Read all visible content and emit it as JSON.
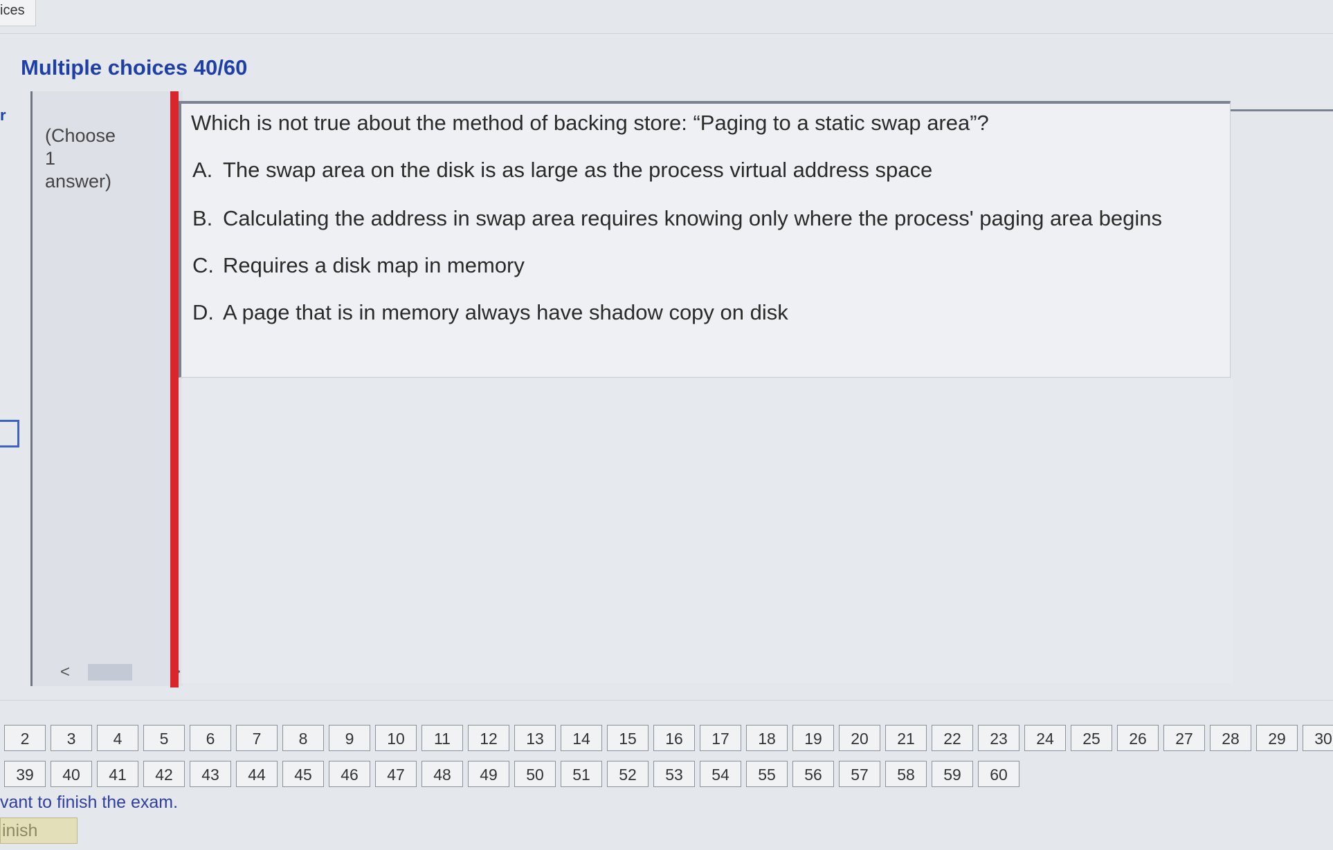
{
  "header": {
    "tab_label": "ices"
  },
  "section": {
    "title": "Multiple choices 40/60"
  },
  "instructions": {
    "line1": "(Choose",
    "line2": "1",
    "line3": "answer)"
  },
  "scroll": {
    "left": "<",
    "right": ">"
  },
  "question": {
    "text": "Which is not true about the method of backing store: “Paging to a static swap area”?",
    "choices": [
      {
        "letter": "A.",
        "text": "The swap area on the disk is as large as the process virtual address space"
      },
      {
        "letter": "B.",
        "text": "Calculating the address in swap area requires knowing only where the process' paging area begins"
      },
      {
        "letter": "C.",
        "text": "Requires a disk map in memory"
      },
      {
        "letter": "D.",
        "text": "A page that is in memory always have shadow copy on disk"
      }
    ]
  },
  "navigation": {
    "row1": [
      "2",
      "3",
      "4",
      "5",
      "6",
      "7",
      "8",
      "9",
      "10",
      "11",
      "12",
      "13",
      "14",
      "15",
      "16",
      "17",
      "18",
      "19",
      "20",
      "21",
      "22",
      "23",
      "24",
      "25",
      "26",
      "27",
      "28",
      "29",
      "30"
    ],
    "row2": [
      "39",
      "40",
      "41",
      "42",
      "43",
      "44",
      "45",
      "46",
      "47",
      "48",
      "49",
      "50",
      "51",
      "52",
      "53",
      "54",
      "55",
      "56",
      "57",
      "58",
      "59",
      "60"
    ]
  },
  "footer": {
    "message": "vant to finish the exam.",
    "finish_label": "inish"
  }
}
